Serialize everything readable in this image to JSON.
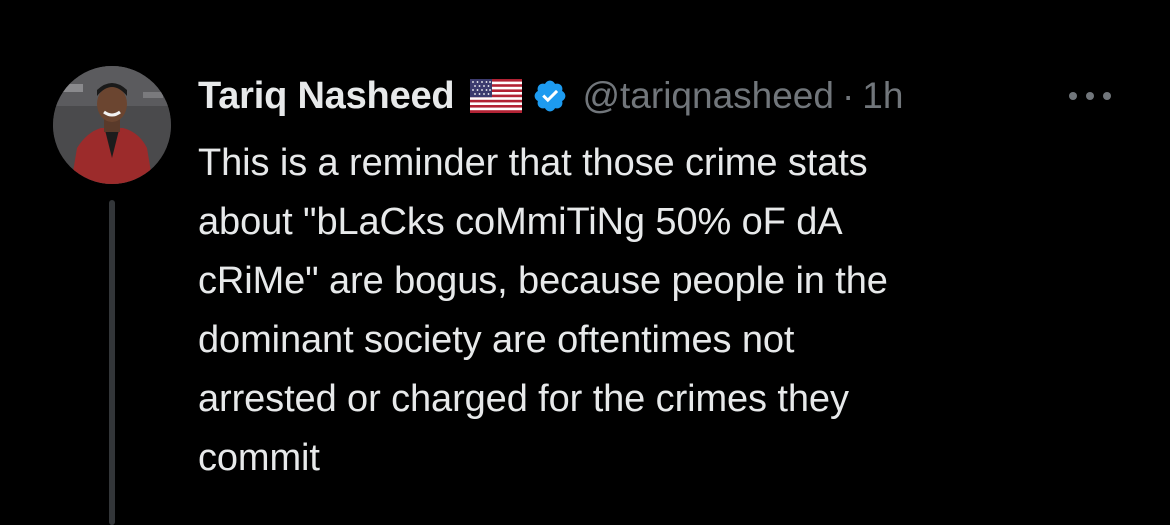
{
  "tweet": {
    "author_name": "Tariq Nasheed",
    "handle": "@tariqnasheed",
    "separator": "·",
    "time": "1h",
    "text": "This is a reminder that those crime stats\nabout \"bLaCks coMmiTiNg 50% oF dA\ncRiMe\" are bogus, because people in the\ndominant society are oftentimes not\narrested or charged for the crimes they\ncommit"
  },
  "icons": {
    "flag": "us-flag-icon",
    "verified": "verified-badge-icon",
    "more": "more-options-icon",
    "avatar": "profile-photo"
  },
  "colors": {
    "background": "#000000",
    "text": "#e7e9ea",
    "secondary": "#71767b",
    "verified": "#1d9bf0",
    "thread_line": "#333639"
  }
}
